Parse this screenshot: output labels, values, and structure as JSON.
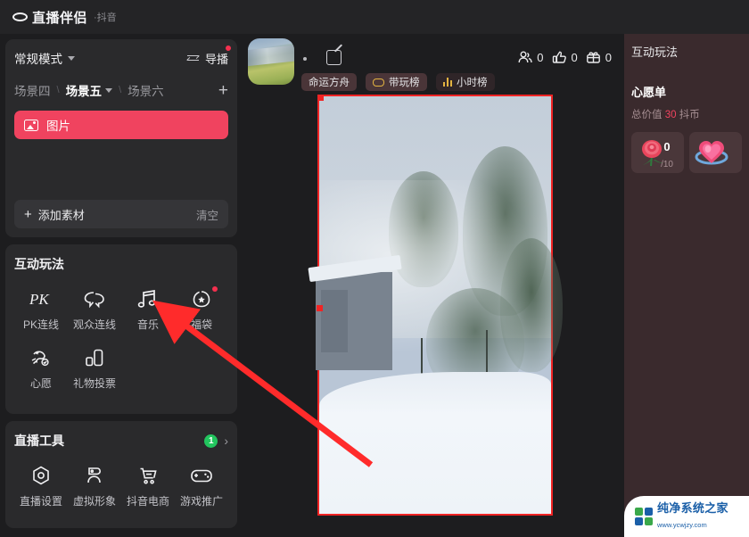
{
  "titlebar": {
    "app_name": "直播伴侣",
    "platform": "·抖音",
    "logo_icon": "ring-logo-icon"
  },
  "sidebar": {
    "scene_panel": {
      "mode_label": "常规模式",
      "mode_chevron_icon": "chevron-down-icon",
      "director_label": "导播",
      "director_icon": "swap-arrows-icon",
      "director_has_badge": true,
      "scene_tabs": [
        {
          "label": "场景四",
          "active": false
        },
        {
          "label": "场景五",
          "active": true
        },
        {
          "label": "场景六",
          "active": false
        }
      ],
      "add_scene_icon": "plus-icon",
      "sources": [
        {
          "label": "图片",
          "icon": "image-icon",
          "selected": true
        }
      ],
      "add_source_label": "添加素材",
      "add_source_icon": "plus-icon",
      "clear_label": "清空"
    },
    "interactive_panel": {
      "title": "互动玩法",
      "items": [
        {
          "label": "PK连线",
          "icon": "pk-icon",
          "badge": false
        },
        {
          "label": "观众连线",
          "icon": "audience-link-icon",
          "badge": false
        },
        {
          "label": "音乐",
          "icon": "music-note-icon",
          "badge": false
        },
        {
          "label": "福袋",
          "icon": "lucky-bag-icon",
          "badge": true
        },
        {
          "label": "心愿",
          "icon": "wish-icon",
          "badge": false
        },
        {
          "label": "礼物投票",
          "icon": "gift-vote-icon",
          "badge": false
        }
      ]
    },
    "tools_panel": {
      "title": "直播工具",
      "badge_count": "1",
      "expand_icon": "chevron-right-icon",
      "items": [
        {
          "label": "直播设置",
          "icon": "settings-hex-icon"
        },
        {
          "label": "虚拟形象",
          "icon": "avatar-person-icon"
        },
        {
          "label": "抖音电商",
          "icon": "shopping-cart-icon"
        },
        {
          "label": "游戏推广",
          "icon": "gamepad-icon"
        }
      ]
    }
  },
  "stream_header": {
    "avatar_icon": "channel-avatar",
    "edit_icon": "edit-pencil-icon",
    "tags": [
      {
        "label": "命运方舟",
        "icon": ""
      },
      {
        "label": "带玩榜",
        "icon": "gamepad-icon"
      },
      {
        "label": "小时榜",
        "icon": "bar-chart-icon"
      }
    ],
    "stats": [
      {
        "icon": "viewers-icon",
        "value": "0"
      },
      {
        "icon": "thumbs-up-icon",
        "value": "0"
      },
      {
        "icon": "gift-box-icon",
        "value": "0"
      }
    ]
  },
  "preview": {
    "selection_color": "#f02424",
    "description": "雪景预览"
  },
  "right_panel": {
    "title": "互动玩法",
    "wish_title": "心愿单",
    "total_value_prefix": "总价值",
    "total_value": "30",
    "total_value_suffix": "抖币",
    "gifts": [
      {
        "icon": "rose-icon",
        "current": "0",
        "target": "/10"
      },
      {
        "icon": "heart-icon",
        "current": "",
        "target": ""
      }
    ]
  },
  "watermark": {
    "name": "纯净系统之家",
    "url": "www.ycwjzy.com"
  },
  "annotation": {
    "arrow_color": "#ff2b2b",
    "points_to": "音乐"
  }
}
